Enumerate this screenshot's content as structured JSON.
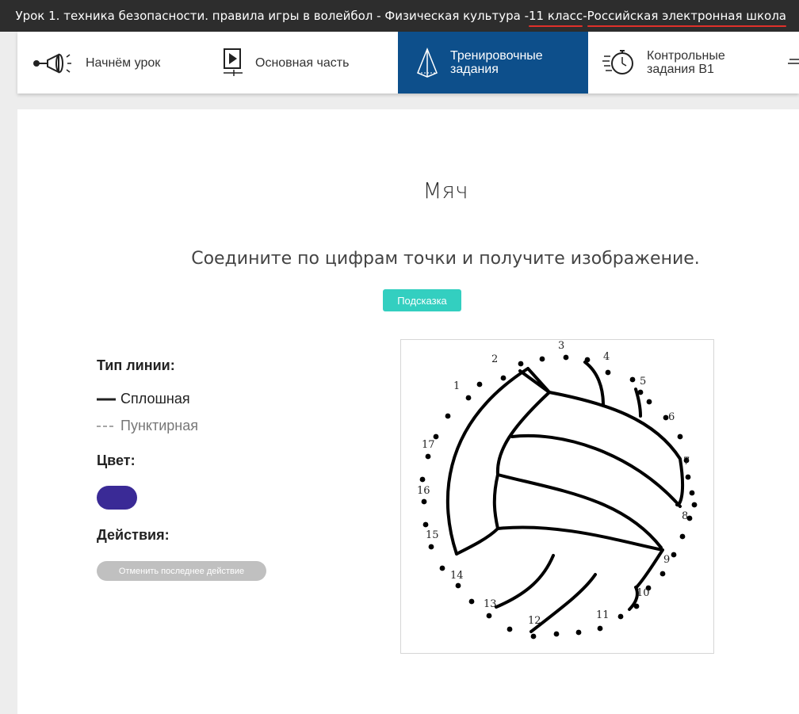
{
  "window": {
    "title_parts": [
      "Урок 1. техника безопасности. правила игры в волейбол - Физическая культура - ",
      "11 класс",
      " - ",
      "Российская электронная школа"
    ]
  },
  "nav": {
    "items": [
      {
        "label": "Начнём урок",
        "icon": "megaphone-icon",
        "active": false
      },
      {
        "label": "Основная часть",
        "icon": "play-icon",
        "active": false
      },
      {
        "label": "Тренировочные задания",
        "icon": "pyramid-icon",
        "active": true
      },
      {
        "label": "Контрольные задания B1",
        "icon": "stopwatch-icon",
        "active": false
      }
    ],
    "colors": {
      "active_bg": "#0d4f8b",
      "active_text": "#ffffff"
    }
  },
  "main": {
    "title": "Мяч",
    "instruction": "Соедините по цифрам точки и получите изображение.",
    "hint_label": "Подсказка"
  },
  "tools": {
    "line_type_heading": "Тип линии:",
    "solid_label": "Сплошная",
    "dashed_label": "Пунктирная",
    "selected_line_type": "solid",
    "color_heading": "Цвет:",
    "selected_color": "#3a2a96",
    "actions_heading": "Действия:",
    "undo_label": "Отменить последнее действие"
  },
  "puzzle": {
    "numbers": [
      "1",
      "2",
      "3",
      "4",
      "5",
      "6",
      "7",
      "8",
      "9",
      "10",
      "11",
      "12",
      "13",
      "14",
      "15",
      "16",
      "17"
    ]
  }
}
